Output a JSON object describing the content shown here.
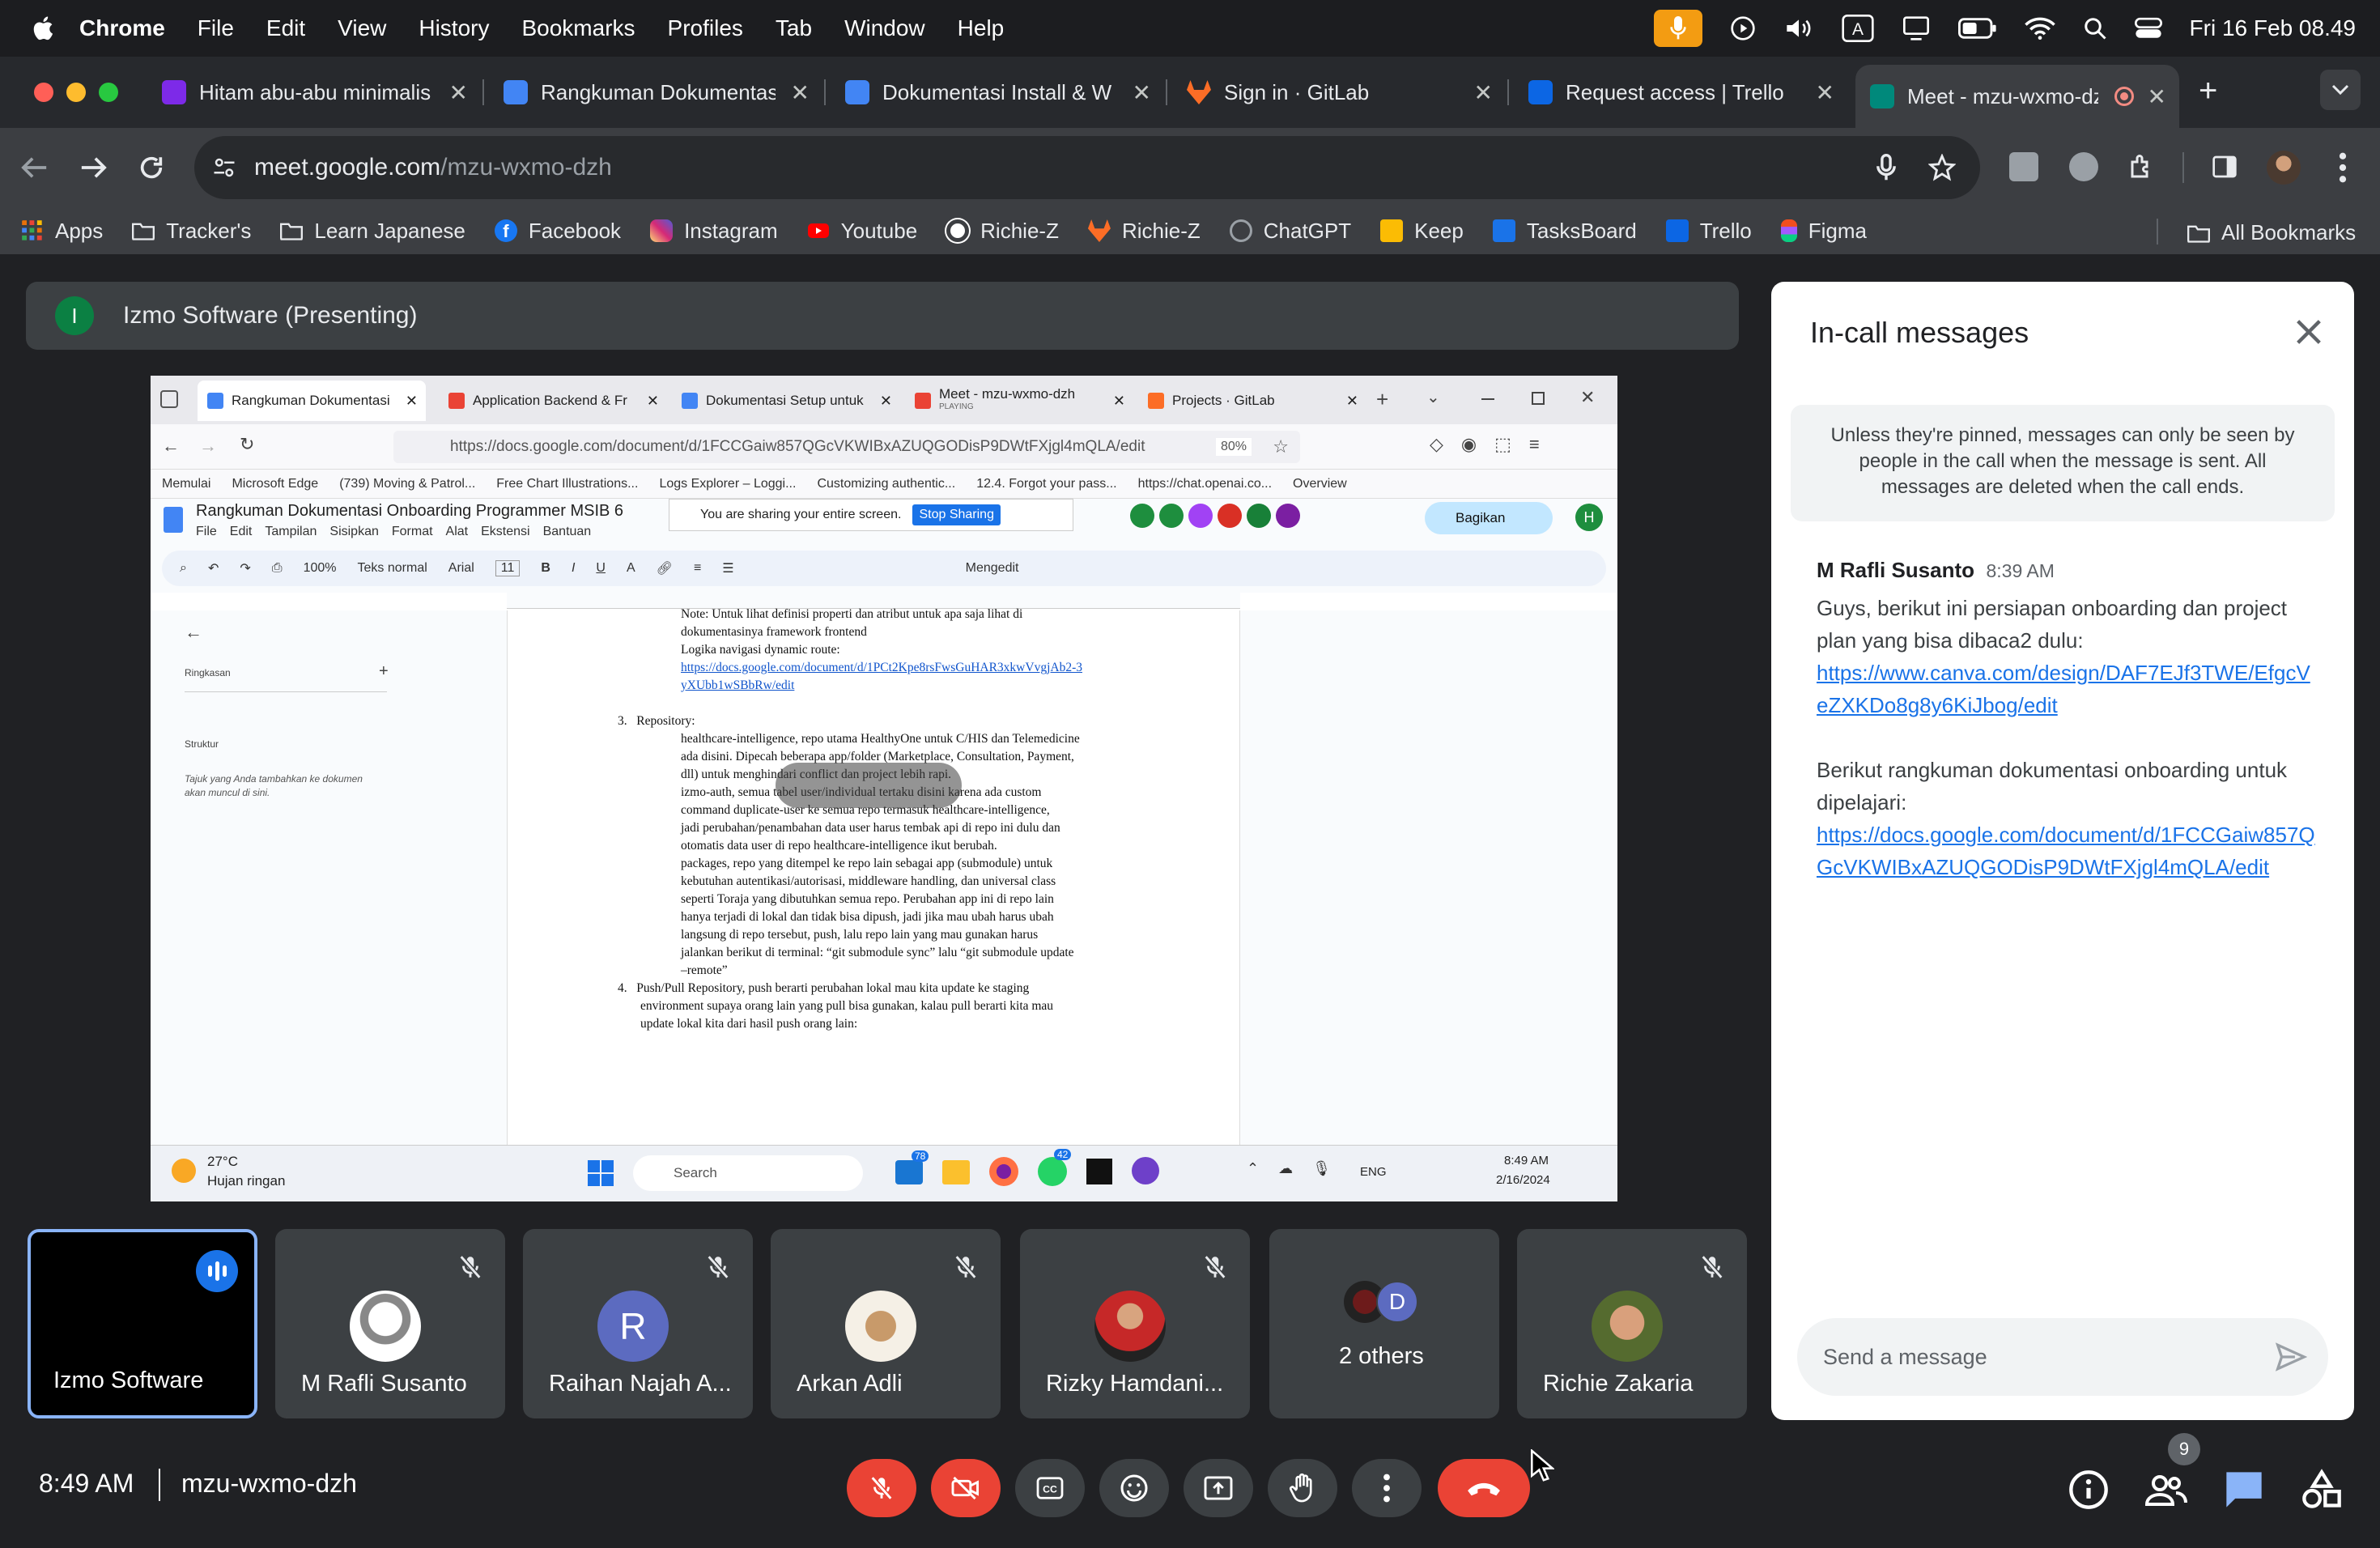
{
  "menubar": {
    "app": "Chrome",
    "items": [
      "File",
      "Edit",
      "View",
      "History",
      "Bookmarks",
      "Profiles",
      "Tab",
      "Window",
      "Help"
    ],
    "datetime": "Fri 16 Feb  08.49"
  },
  "tabs": [
    {
      "title": "Hitam abu-abu minimalis",
      "color": "#7d2ae8"
    },
    {
      "title": "Rangkuman Dokumentasi",
      "color": "#4285f4"
    },
    {
      "title": "Dokumentasi Install & W",
      "color": "#4285f4"
    },
    {
      "title": "Sign in · GitLab",
      "color": "#fc6d26"
    },
    {
      "title": "Request access | Trello",
      "color": "#0c66e4"
    },
    {
      "title": "Meet - mzu-wxmo-dzh",
      "color": "#00897b"
    }
  ],
  "omnibox": {
    "host": "meet.google.com",
    "path": "/mzu-wxmo-dzh"
  },
  "bookmarks": [
    {
      "label": "Apps",
      "color": "#e8710a"
    },
    {
      "label": "Tracker's",
      "color": "#9aa0a6"
    },
    {
      "label": "Learn Japanese",
      "color": "#9aa0a6"
    },
    {
      "label": "Facebook",
      "color": "#1877f2"
    },
    {
      "label": "Instagram",
      "color": "#e1306c"
    },
    {
      "label": "Youtube",
      "color": "#ff0000"
    },
    {
      "label": "Richie-Z",
      "color": "#ffffff"
    },
    {
      "label": "Richie-Z",
      "color": "#fc6d26"
    },
    {
      "label": "ChatGPT",
      "color": "#9aa0a6"
    },
    {
      "label": "Keep",
      "color": "#fbbc04"
    },
    {
      "label": "TasksBoard",
      "color": "#1a73e8"
    },
    {
      "label": "Trello",
      "color": "#0c66e4"
    },
    {
      "label": "Figma",
      "color": "#f24e1e"
    }
  ],
  "all_bookmarks": "All Bookmarks",
  "presenter": {
    "initial": "I",
    "label": "Izmo Software (Presenting)"
  },
  "shared": {
    "tabs": [
      "Rangkuman Dokumentasi",
      "Application Backend & Fr",
      "Dokumentasi Setup untuk",
      "Meet - mzu-wxmo-dzh",
      "Projects · GitLab"
    ],
    "meet_sub": "PLAYING",
    "url": "https://docs.google.com/document/d/1FCCGaiw857QGcVKWIBxAZUQGODisP9DWtFXjgl4mQLA/edit",
    "zoom": "80%",
    "bookmarks": [
      "Memulai",
      "Microsoft Edge",
      "(739) Moving & Patrol...",
      "Free Chart Illustrations...",
      "Logs Explorer – Loggi...",
      "Customizing authentic...",
      "12.4. Forgot your pass...",
      "https://chat.openai.co...",
      "Overview"
    ],
    "doc_title": "Rangkuman Dokumentasi Onboarding Programmer MSIB 6",
    "doc_menu": [
      "File",
      "Edit",
      "Tampilan",
      "Sisipkan",
      "Format",
      "Alat",
      "Ekstensi",
      "Bantuan"
    ],
    "sharing_notice": "You are sharing your entire screen.",
    "stop_sharing": "Stop Sharing",
    "share_btn": "Bagikan",
    "toolbar_zoom": "100%",
    "style": "Teks normal",
    "font": "Arial",
    "font_size": "11",
    "mode": "Mengedit",
    "outline_title": "Ringkasan",
    "outline_struct": "Struktur",
    "outline_hint": "Tajuk yang Anda tambahkan ke dokumen akan muncul di sini.",
    "doc_lines": [
      "Note: Untuk lihat definisi properti dan atribut untuk apa saja lihat di",
      "dokumentasinya framework frontend",
      "Logika navigasi dynamic route:",
      "https://docs.google.com/document/d/1PCt2Kpe8rsFwsGuHAR3xkwVvgjAb2-3",
      "yXUbb1wSBbRw/edit",
      "3.   Repository:",
      "healthcare-intelligence, repo utama HealthyOne untuk C/HIS dan Telemedicine",
      "ada disini. Dipecah beberapa app/folder (Marketplace, Consultation, Payment,",
      "dll) untuk menghindari conflict dan project lebih rapi.",
      "izmo-auth, semua tabel user/individual tertaku disini karena ada custom",
      "command duplicate-user ke semua repo termasuk healthcare-intelligence,",
      "jadi perubahan/penambahan data user harus tembak api di repo ini dulu dan",
      "otomatis data user di repo healthcare-intelligence ikut berubah.",
      "packages, repo yang ditempel ke repo lain sebagai app (submodule) untuk",
      "kebutuhan autentikasi/autorisasi, middleware handling, dan universal class",
      "seperti Toraja yang dibutuhkan semua repo. Perubahan app ini di repo lain",
      "hanya terjadi di lokal dan tidak bisa dipush, jadi jika mau ubah harus ubah",
      "langsung di repo tersebut, push, lalu repo lain yang mau gunakan harus",
      "jalankan berikut di terminal: “git submodule sync” lalu “git submodule update",
      "–remote”",
      "4.   Push/Pull Repository, push berarti perubahan lokal mau kita update ke staging",
      "environment supaya orang lain yang pull bisa gunakan, kalau pull berarti kita mau",
      "update lokal kita dari hasil push orang lain:"
    ],
    "weather_temp": "27°C",
    "weather_desc": "Hujan ringan",
    "taskbar_search": "Search",
    "badge_mail": "78",
    "badge_wa": "42",
    "lang": "ENG",
    "clock_time": "8:49 AM",
    "clock_date": "2/16/2024"
  },
  "participants": [
    {
      "name": "Izmo Software",
      "speaking": true
    },
    {
      "name": "M Rafli Susanto"
    },
    {
      "name": "Raihan Najah A...",
      "initial": "R",
      "color": "#5c6bc0"
    },
    {
      "name": "Arkan Adli"
    },
    {
      "name": "Rizky Hamdani..."
    },
    {
      "name": "2 others",
      "initial": "D",
      "color": "#5c6bc0"
    },
    {
      "name": "Richie Zakaria"
    }
  ],
  "chat": {
    "title": "In-call messages",
    "notice": "Unless they're pinned, messages can only be seen by people in the call when the message is sent. All messages are deleted when the call ends.",
    "sender": "M Rafli Susanto",
    "time": "8:39 AM",
    "msg1": "Guys, berikut ini persiapan onboarding dan project plan yang bisa dibaca2 dulu:",
    "link1": "https://www.canva.com/design/DAF7EJf3TWE/EfgcVeZXKDo8g8y6KiJbog/edit",
    "msg2": "Berikut rangkuman dokumentasi onboarding untuk dipelajari:",
    "link2": "https://docs.google.com/document/d/1FCCGaiw857QGcVKWIBxAZUQGODisP9DWtFXjgl4mQLA/edit",
    "placeholder": "Send a message"
  },
  "bottom": {
    "time": "8:49 AM",
    "meeting_code": "mzu-wxmo-dzh",
    "people_count": "9"
  }
}
